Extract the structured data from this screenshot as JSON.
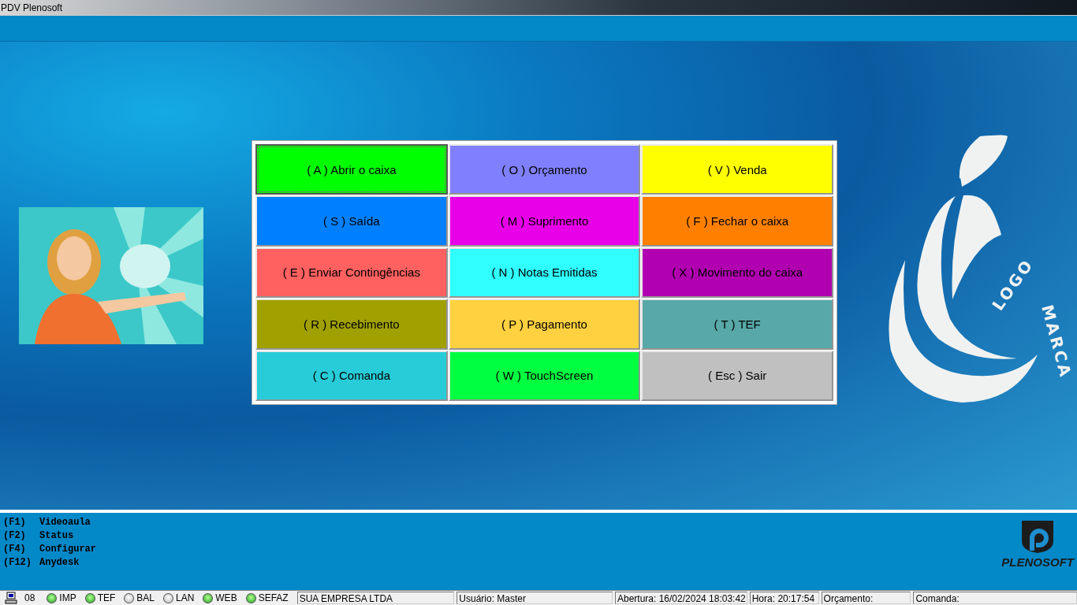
{
  "window": {
    "title": "PDV Plenosoft"
  },
  "menu_buttons": [
    {
      "label": "( A ) Abrir o caixa",
      "color": "#00ff00",
      "selected": true
    },
    {
      "label": "( O ) Orçamento",
      "color": "#8080ff",
      "selected": false
    },
    {
      "label": "( V )  Venda",
      "color": "#ffff00",
      "selected": false
    },
    {
      "label": "( S ) Saída",
      "color": "#0080ff",
      "selected": false
    },
    {
      "label": "( M ) Suprimento",
      "color": "#e800e8",
      "selected": false
    },
    {
      "label": "( F ) Fechar o caixa",
      "color": "#ff8000",
      "selected": false
    },
    {
      "label": "( E ) Enviar Contingências",
      "color": "#ff6060",
      "selected": false
    },
    {
      "label": "( N ) Notas Emitidas",
      "color": "#30ffff",
      "selected": false
    },
    {
      "label": "( X ) Movimento do caixa",
      "color": "#b000b0",
      "selected": false
    },
    {
      "label": "( R ) Recebimento",
      "color": "#a0a000",
      "selected": false
    },
    {
      "label": "( P ) Pagamento",
      "color": "#ffd040",
      "selected": false
    },
    {
      "label": "( T ) TEF",
      "color": "#58a8a8",
      "selected": false
    },
    {
      "label": "( C ) Comanda",
      "color": "#28ccd8",
      "selected": false
    },
    {
      "label": "( W ) TouchScreen",
      "color": "#00ff40",
      "selected": false
    },
    {
      "label": "( Esc ) Sair",
      "color": "#c0c0c0",
      "selected": false
    }
  ],
  "logo": {
    "text_1": "LOGO",
    "text_2": "MARCA"
  },
  "shortcuts": [
    {
      "key": "(F1)",
      "label": "Videoaula"
    },
    {
      "key": "(F2)",
      "label": "Status"
    },
    {
      "key": "(F4)",
      "label": "Configurar"
    },
    {
      "key": "(F12)",
      "label": "Anydesk"
    }
  ],
  "brand": "PLENOSOFT",
  "status_bar": {
    "terminal": "08",
    "indicators": [
      {
        "label": "IMP",
        "on": true
      },
      {
        "label": "TEF",
        "on": true
      },
      {
        "label": "BAL",
        "on": false
      },
      {
        "label": "LAN",
        "on": false
      },
      {
        "label": "WEB",
        "on": true
      },
      {
        "label": "SEFAZ",
        "on": true
      }
    ],
    "fields": [
      "SUA EMPRESA LTDA",
      "Usuário: Master",
      "Abertura: 16/02/2024 18:03:42",
      "Hora: 20:17:54",
      "Orçamento:",
      "Comanda:"
    ]
  }
}
